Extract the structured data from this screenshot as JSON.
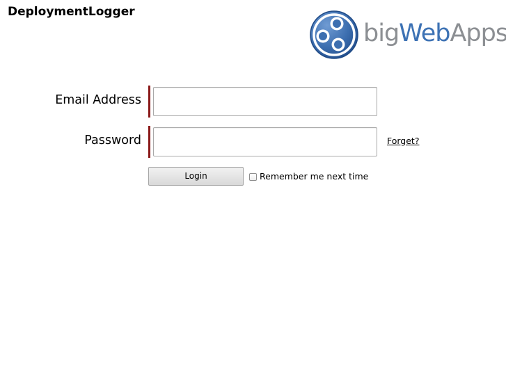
{
  "header": {
    "app_title": "DeploymentLogger",
    "brand": {
      "icon": "bigwebapps-logo-icon",
      "word_part_1": "big",
      "word_part_2": "Web",
      "word_part_3": "Apps",
      "colors": {
        "gray": "#8c8f93",
        "blue": "#3d72b4"
      }
    }
  },
  "login_form": {
    "email": {
      "label": "Email Address",
      "value": "",
      "placeholder": ""
    },
    "password": {
      "label": "Password",
      "value": "",
      "placeholder": ""
    },
    "forget_link": "Forget?",
    "login_button": "Login",
    "remember": {
      "label": "Remember me next time",
      "checked": false
    },
    "required_marker_color": "#8b1a1a"
  }
}
